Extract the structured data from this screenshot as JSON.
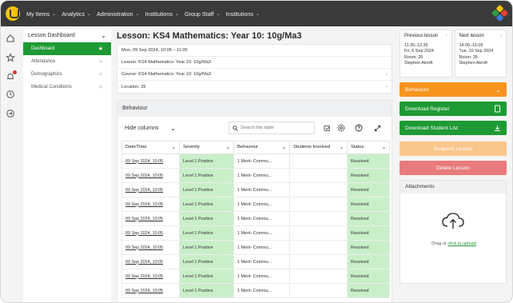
{
  "topnav": {
    "items": [
      {
        "label": "My Items"
      },
      {
        "label": "Analytics"
      },
      {
        "label": "Administration"
      },
      {
        "label": "Institutions"
      },
      {
        "label": "Group Staff"
      },
      {
        "label": "Institutions"
      }
    ],
    "chevron": "⌄"
  },
  "rail": {
    "icons": [
      "home-icon",
      "star-icon",
      "bell-icon",
      "clock-icon",
      "logout-icon"
    ]
  },
  "side": {
    "header": "Lesson Dashboard",
    "items": [
      {
        "label": "Dashboard",
        "active": true
      },
      {
        "label": "Attendance",
        "active": false
      },
      {
        "label": "Demographics",
        "active": false
      },
      {
        "label": "Medical Conditions",
        "active": false
      }
    ]
  },
  "lesson": {
    "title": "Lesson: KS4 Mathematics: Year 10: 10g/Ma3",
    "datetime": "Mon, 09 Sep 2024, 10:05 – 11:05",
    "lesson_label": "Lesson:",
    "lesson_value": "KS4 Mathematics: Year 10: 10g/Ma3",
    "course_label": "Course:",
    "course_value": "KS4 Mathematics: Year 10: 10g/Ma3",
    "location_label": "Location:",
    "location_value": "35"
  },
  "behaviour": {
    "panel_title": "Behaviour",
    "hide_columns": "Hide columns",
    "search_placeholder": "Search this table",
    "columns": [
      "Date/Time",
      "Severity",
      "Behaviour",
      "Students Involved",
      "Status"
    ],
    "rows": [
      [
        "09 Sep 2024, 10:05",
        "Level 1 Positive",
        "1 Merit- Commu...",
        "",
        "Resolved"
      ],
      [
        "09 Sep 2024, 10:05",
        "Level 1 Positive",
        "1 Merit- Commu...",
        "",
        "Resolved"
      ],
      [
        "09 Sep 2024, 10:05",
        "Level 1 Positive",
        "1 Merit- Commu...",
        "",
        "Resolved"
      ],
      [
        "09 Sep 2024, 10:05",
        "Level 1 Positive",
        "1 Merit- Commu...",
        "",
        "Resolved"
      ],
      [
        "09 Sep 2024, 10:05",
        "Level 1 Positive",
        "1 Merit- Commu...",
        "",
        "Resolved"
      ],
      [
        "09 Sep 2024, 10:05",
        "Level 1 Positive",
        "1 Merit- Commu...",
        "",
        "Resolved"
      ],
      [
        "09 Sep 2024, 10:05",
        "Level 1 Positive",
        "1 Merit- Commu...",
        "",
        "Resolved"
      ],
      [
        "09 Sep 2024, 10:05",
        "Level 1 Positive",
        "1 Merit- Commu...",
        "",
        "Resolved"
      ],
      [
        "09 Sep 2024, 10:05",
        "Level 1 Positive",
        "1 Merit- Commu...",
        "",
        "Resolved"
      ],
      [
        "09 Sep 2024, 10:05",
        "Level 1 Positive",
        "1 Merit- Commu...",
        "",
        "Resolved"
      ]
    ]
  },
  "right": {
    "prev": {
      "title": "Previous lesson",
      "time": "11:35–12:35",
      "date": "Fri, 6 Sep 2024",
      "room": "Room: 35",
      "teacher": "Stephen Akroft"
    },
    "next": {
      "title": "Next lesson",
      "time": "14:05–15:05",
      "date": "Tue, 10 Sep 2024",
      "room": "Room: 35",
      "teacher": "Stephen Akroft"
    },
    "behaviour_btn": "Behaviour",
    "download_register": "Download Register",
    "download_students": "Download Student List",
    "suspend": "Suspend Lesson",
    "delete": "Delete Lesson",
    "attachments": "Attachments",
    "drag_text": "Drag or",
    "upload_link": "click to upload"
  },
  "colors": {
    "green": "#1e9a34",
    "orange": "#f7941d",
    "peach": "#f9c68c",
    "red": "#e87b7b",
    "positive_fill": "#c9efc9",
    "nav_bg": "#3a3a3a"
  }
}
